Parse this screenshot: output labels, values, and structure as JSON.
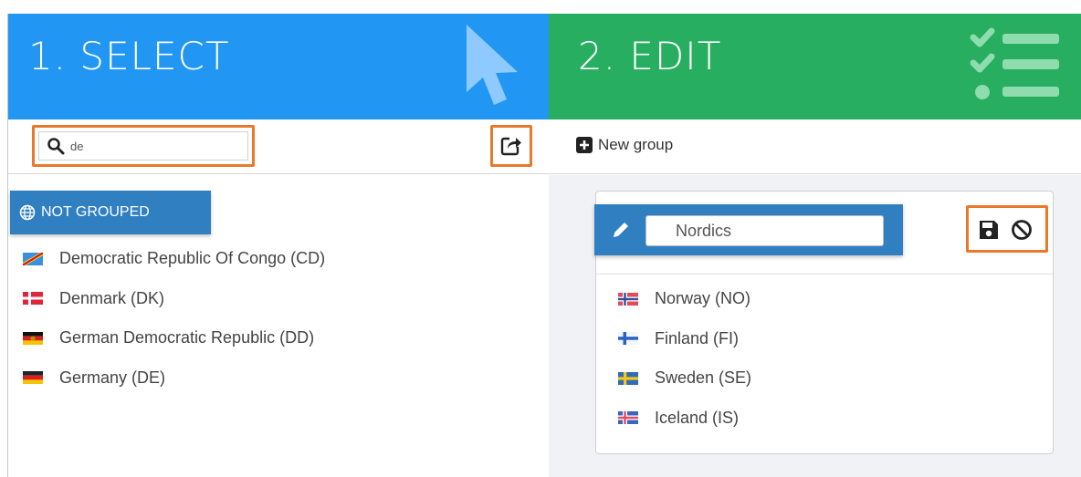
{
  "header": {
    "select_title": "1. SELECT",
    "edit_title": "2. EDIT",
    "select_color": "#2196f3",
    "edit_color": "#27ae60"
  },
  "toolbar": {
    "search_value": "de",
    "new_group_label": "New group"
  },
  "left": {
    "group_label": "NOT GROUPED",
    "countries": [
      {
        "name": "Democratic Republic Of Congo (CD)",
        "flag": "flag-cd"
      },
      {
        "name": "Denmark (DK)",
        "flag": "flag-dk"
      },
      {
        "name": "German Democratic Republic (DD)",
        "flag": "flag-dd"
      },
      {
        "name": "Germany (DE)",
        "flag": "flag-de"
      }
    ]
  },
  "right": {
    "group_name": "Nordics",
    "members": [
      {
        "name": "Norway (NO)",
        "flag": "flag-no"
      },
      {
        "name": "Finland (FI)",
        "flag": "flag-fi"
      },
      {
        "name": "Sweden (SE)",
        "flag": "flag-se"
      },
      {
        "name": "Iceland (IS)",
        "flag": "flag-is"
      }
    ]
  },
  "highlight_color": "#e8792b"
}
